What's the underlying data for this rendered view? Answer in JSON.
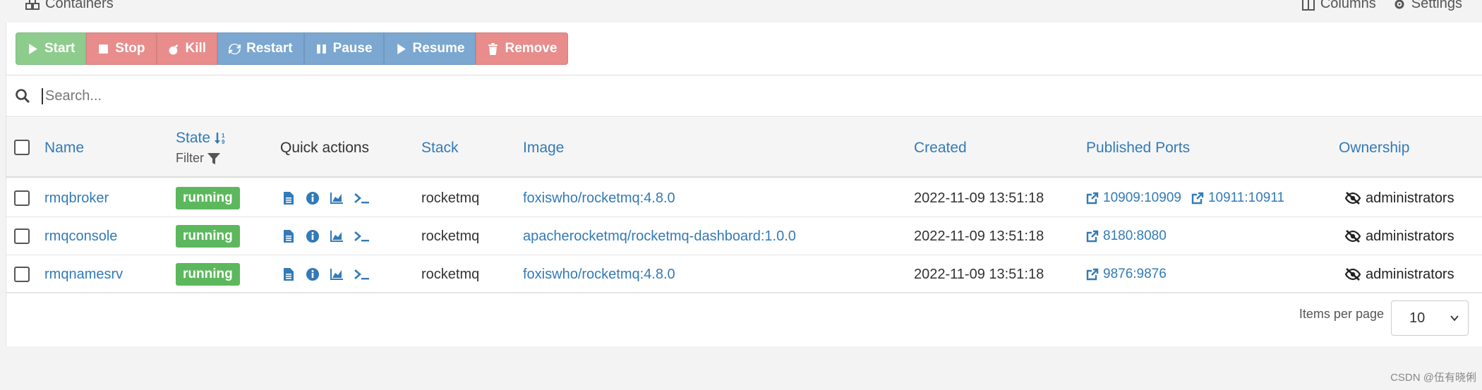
{
  "panel": {
    "title": "Containers",
    "columns_label": "Columns",
    "settings_label": "Settings"
  },
  "toolbar": {
    "start": "Start",
    "stop": "Stop",
    "kill": "Kill",
    "restart": "Restart",
    "pause": "Pause",
    "resume": "Resume",
    "remove": "Remove"
  },
  "search": {
    "placeholder": "Search..."
  },
  "table": {
    "headers": {
      "name": "Name",
      "state": "State",
      "state_filter": "Filter",
      "quick_actions": "Quick actions",
      "stack": "Stack",
      "image": "Image",
      "created": "Created",
      "published_ports": "Published Ports",
      "ownership": "Ownership"
    },
    "rows": [
      {
        "name": "rmqbroker",
        "state": "running",
        "stack": "rocketmq",
        "image": "foxiswho/rocketmq:4.8.0",
        "created": "2022-11-09 13:51:18",
        "ports": [
          "10909:10909",
          "10911:10911"
        ],
        "ownership": "administrators"
      },
      {
        "name": "rmqconsole",
        "state": "running",
        "stack": "rocketmq",
        "image": "apacherocketmq/rocketmq-dashboard:1.0.0",
        "created": "2022-11-09 13:51:18",
        "ports": [
          "8180:8080"
        ],
        "ownership": "administrators"
      },
      {
        "name": "rmqnamesrv",
        "state": "running",
        "stack": "rocketmq",
        "image": "foxiswho/rocketmq:4.8.0",
        "created": "2022-11-09 13:51:18",
        "ports": [
          "9876:9876"
        ],
        "ownership": "administrators"
      }
    ]
  },
  "pagination": {
    "items_per_page_label": "Items per page",
    "items_per_page_value": "10"
  },
  "watermark": "CSDN @伍有晓俐",
  "colors": {
    "link": "#337ab7",
    "running": "#5cb85c",
    "start": "#8dcc8d",
    "danger": "#e88c8c",
    "primary": "#7ba7d0"
  }
}
